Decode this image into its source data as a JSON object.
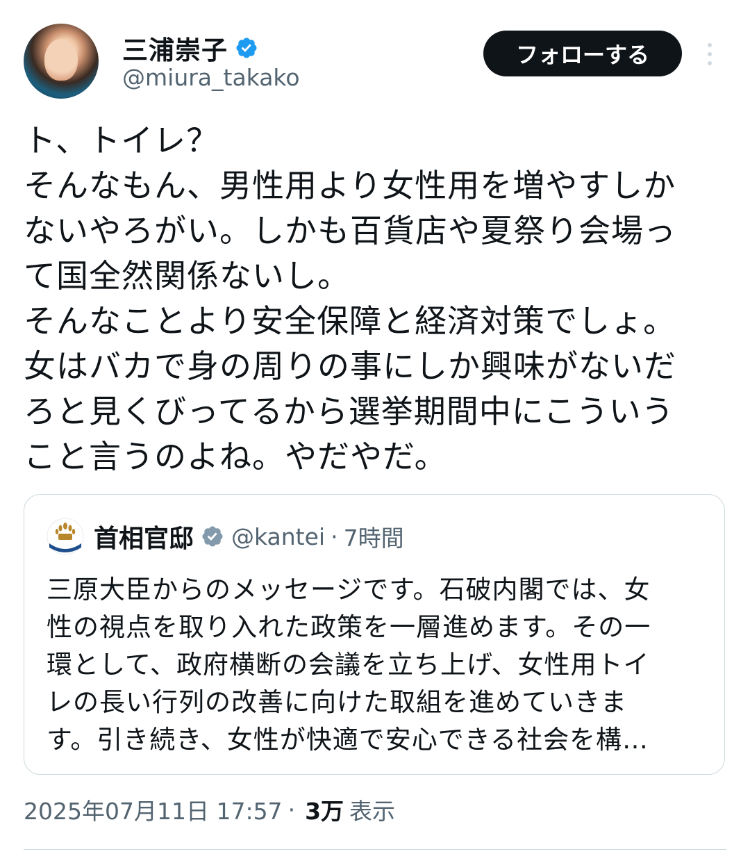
{
  "author": {
    "display_name": "三浦崇子",
    "handle": "@miura_takako",
    "verified_color": "#1d9bf0"
  },
  "follow_label": "フォローする",
  "tweet": {
    "text": "ト、トイレ？\nそんなもん、男性用より女性用を増やすしか\nないやろがい。しかも百貨店や夏祭り会場っ\nて国全然関係ないし。\nそんなことより安全保障と経済対策でしょ。\n女はバカで身の周りの事にしか興味がないだ\nろと見くびってるから選挙期間中にこういう\nこと言うのよね。やだやだ。"
  },
  "quoted": {
    "display_name": "首相官邸",
    "handle": "@kantei",
    "separator": "·",
    "time": "7時間",
    "verified_color": "#829aab",
    "text": "三原大臣からのメッセージです。石破内閣では、女\n性の視点を取り入れた政策を一層進めます。その一\n環として、政府横断の会議を立ち上げ、女性用トイ\nレの長い行列の改善に向けた取組を進めていきま\nす。引き続き、女性が快適で安心できる社会を構…"
  },
  "meta": {
    "timestamp": "2025年07月11日 17:57",
    "separator": "·",
    "views_count": "3万",
    "views_label": "表示"
  }
}
